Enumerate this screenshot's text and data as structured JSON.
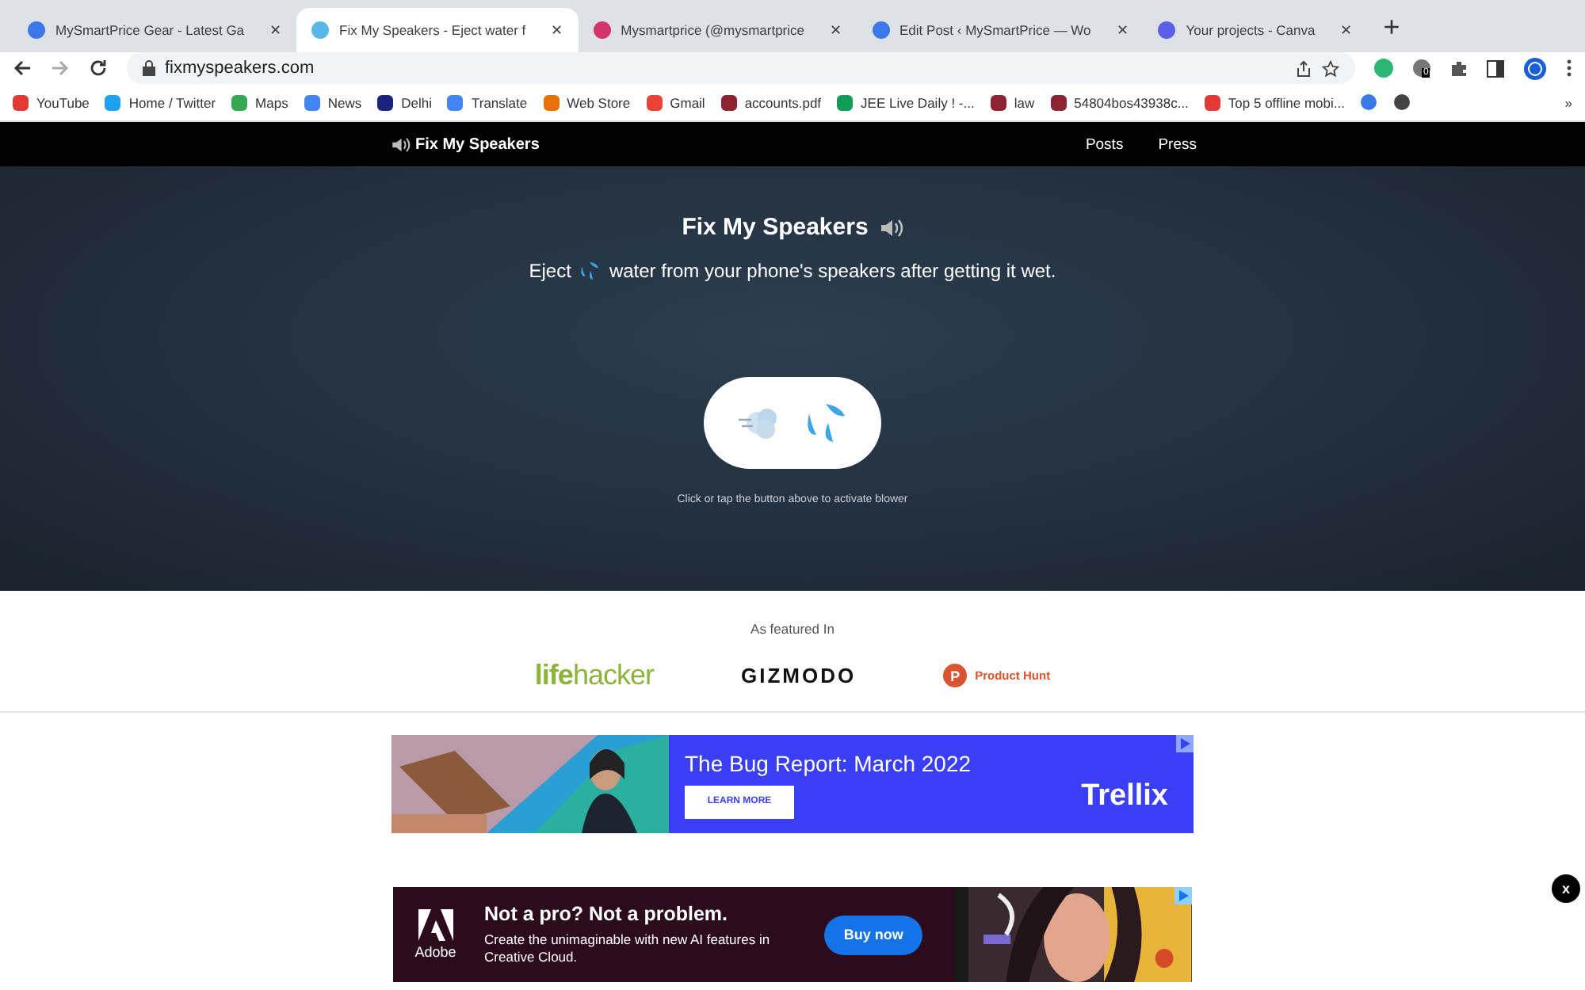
{
  "browser": {
    "tabs": [
      {
        "title": "MySmartPrice Gear - Latest Ga",
        "selected": false
      },
      {
        "title": "Fix My Speakers - Eject water f",
        "selected": true
      },
      {
        "title": "Mysmartprice (@mysmartprice",
        "selected": false
      },
      {
        "title": "Edit Post ‹ MySmartPrice — Wo",
        "selected": false
      },
      {
        "title": "Your projects - Canva",
        "selected": false
      }
    ],
    "tab_close": "✕",
    "new_tab": "+",
    "url": "fixmyspeakers.com",
    "extension_badge": "0",
    "bookmarks": [
      "YouTube",
      "Home / Twitter",
      "Maps",
      "News",
      "Delhi",
      "Translate",
      "Web Store",
      "Gmail",
      "accounts.pdf",
      "JEE Live Daily ! -...",
      "law",
      "54804bos43938c...",
      "Top 5 offline mobi..."
    ],
    "more_bookmarks": "»"
  },
  "site_nav": {
    "brand": "Fix My Speakers",
    "links": [
      "Posts",
      "Press"
    ]
  },
  "hero": {
    "title": "Fix My Speakers",
    "subtitle_before": "Eject",
    "subtitle_after": "water from your phone's speakers after getting it wet.",
    "hint": "Click or tap the button above to activate blower"
  },
  "featured": {
    "heading": "As featured In",
    "logos": [
      {
        "kind": "lifehacker",
        "text_a": "life",
        "text_b": "hacker"
      },
      {
        "kind": "gizmodo",
        "text_a": "GIZMODO"
      },
      {
        "kind": "producthunt",
        "text_a": "Product Hunt",
        "mark": "P"
      }
    ]
  },
  "ad_banner": {
    "headline": "The Bug Report: March 2022",
    "button": "LEARN MORE",
    "brand": "Trellix"
  },
  "sticky_ad": {
    "brand": "Adobe",
    "headline": "Not a pro? Not a problem.",
    "body": "Create the unimaginable with new AI features in Creative Cloud.",
    "button": "Buy now",
    "close": "x"
  }
}
